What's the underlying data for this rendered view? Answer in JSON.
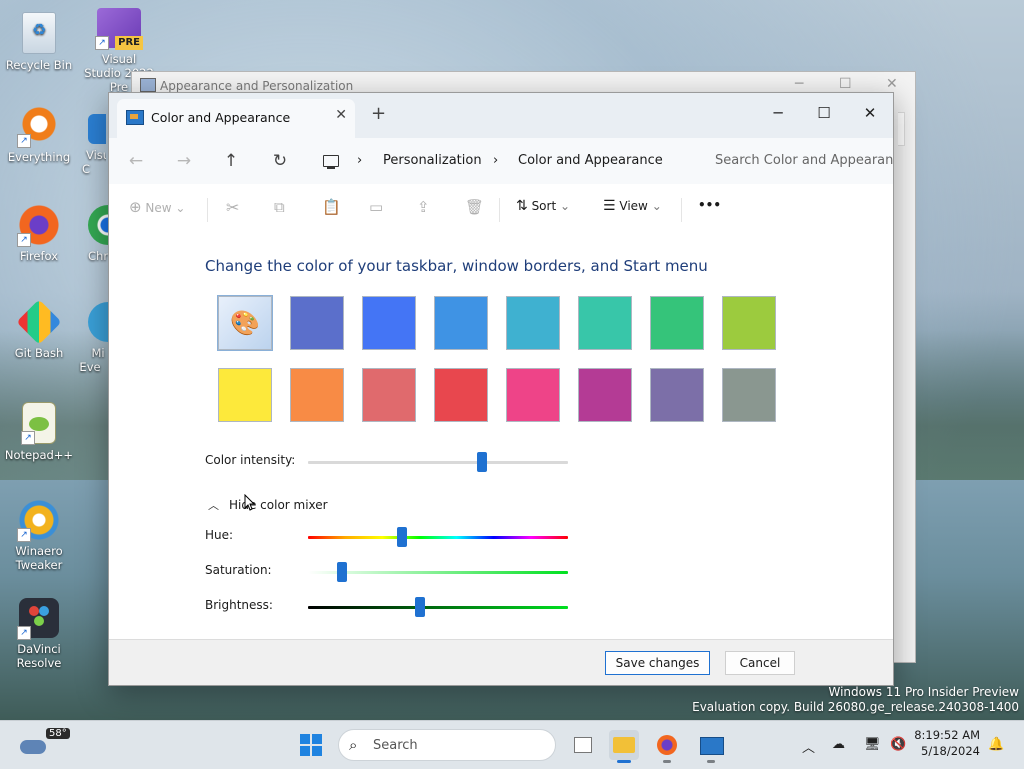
{
  "desktop": {
    "icons": [
      {
        "label": "Recycle Bin"
      },
      {
        "label": "Visual Studio 2022 Pre",
        "badge": "PRE"
      },
      {
        "label": "Everything"
      },
      {
        "label": "Visu C"
      },
      {
        "label": "Firefox"
      },
      {
        "label": "Chr"
      },
      {
        "label": "Git Bash"
      },
      {
        "label": "Mi Eve"
      },
      {
        "label": "Notepad++"
      },
      {
        "label": "Winaero Tweaker"
      },
      {
        "label": "DaVinci Resolve"
      }
    ],
    "watermark_line1": "Windows 11 Pro Insider Preview",
    "watermark_line2": "Evaluation copy. Build 26080.ge_release.240308-1400"
  },
  "bg_window": {
    "title": "Appearance and Personalization"
  },
  "window": {
    "tab_title": "Color and Appearance",
    "new_tab": "+",
    "controls": {
      "minimize": "─",
      "maximize": "☐",
      "close": "✕"
    }
  },
  "nav": {
    "back": "←",
    "forward": "→",
    "up": "↑",
    "refresh": "↻",
    "breadcrumb": [
      "Personalization",
      "Color and Appearance"
    ],
    "separator": "›",
    "search_placeholder": "Search Color and Appearance"
  },
  "commandbar": {
    "new": "New",
    "sort": "Sort",
    "view": "View",
    "more": "•••"
  },
  "content": {
    "heading": "Change the color of your taskbar, window borders, and Start menu",
    "swatches_row1": [
      "#ffffff",
      "#5b6fcb",
      "#4475f5",
      "#3f93e4",
      "#3fb1d0",
      "#38c6a9",
      "#35c47a",
      "#9ccb3e"
    ],
    "swatches_row2": [
      "#fde93b",
      "#f88b45",
      "#e06a6d",
      "#e8474e",
      "#ee4488",
      "#b43b95",
      "#7c6fa8",
      "#8a9790"
    ],
    "selected_swatch": 0,
    "intensity_label": "Color intensity:",
    "intensity_value": 0.67,
    "mixer_toggle": "Hide color mixer",
    "hue_label": "Hue:",
    "hue_value": 0.36,
    "saturation_label": "Saturation:",
    "saturation_value": 0.13,
    "brightness_label": "Brightness:",
    "brightness_value": 0.43
  },
  "footer": {
    "save": "Save changes",
    "cancel": "Cancel"
  },
  "taskbar": {
    "temperature": "58°",
    "search_placeholder": "Search",
    "time": "8:19:52 AM",
    "date": "5/18/2024"
  }
}
